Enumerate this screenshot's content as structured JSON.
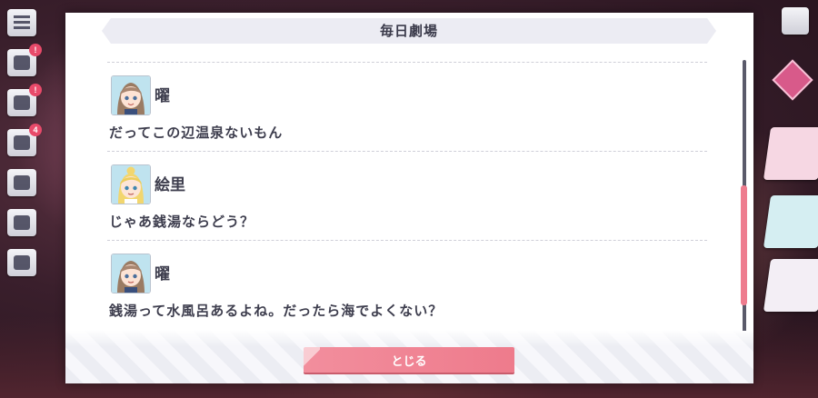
{
  "dialog": {
    "title": "毎日劇場",
    "close_label": "とじる"
  },
  "log": [
    {
      "speaker": "曜",
      "avatar": "you-avatar",
      "text": "だってこの辺温泉ないもん"
    },
    {
      "speaker": "絵里",
      "avatar": "eli-avatar",
      "text": "じゃあ銭湯ならどう？"
    },
    {
      "speaker": "曜",
      "avatar": "you-avatar",
      "text": "銭湯って水風呂あるよね。だったら海でよくない？"
    }
  ],
  "background": {
    "side_badges": [
      "!",
      "!",
      "4"
    ],
    "accent_color": "#ee7b8c"
  },
  "scroll": {
    "position_fraction": 0.6
  }
}
